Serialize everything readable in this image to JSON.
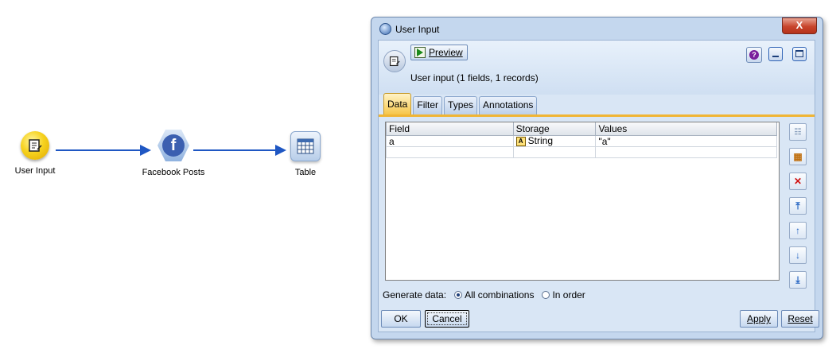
{
  "canvas": {
    "nodes": [
      {
        "label": "User Input",
        "icon": "user-input-icon"
      },
      {
        "label": "Facebook Posts",
        "icon": "facebook-icon"
      },
      {
        "label": "Table",
        "icon": "table-icon"
      }
    ],
    "facebook_glyph": "f"
  },
  "dialog": {
    "title": "User Input",
    "close_glyph": "X",
    "preview_label": "Preview",
    "help_glyph": "?",
    "summary": "User input (1 fields, 1 records)",
    "tabs": [
      {
        "label": "Data",
        "active": true
      },
      {
        "label": "Filter",
        "active": false
      },
      {
        "label": "Types",
        "active": false
      },
      {
        "label": "Annotations",
        "active": false
      }
    ],
    "table": {
      "headers": [
        "Field",
        "Storage",
        "Values"
      ],
      "rows": [
        {
          "field": "a",
          "storage_badge": "A",
          "storage": "String",
          "values": "\"a\""
        }
      ]
    },
    "tools": [
      "specify-values-icon",
      "add-field-icon",
      "delete-icon",
      "move-top-icon",
      "move-up-icon",
      "move-down-icon",
      "move-bottom-icon"
    ],
    "generate": {
      "label": "Generate data:",
      "options": [
        {
          "label": "All combinations",
          "selected": true
        },
        {
          "label": "In order",
          "selected": false
        }
      ]
    },
    "buttons": {
      "ok": "OK",
      "cancel": "Cancel",
      "apply": "Apply",
      "reset": "Reset"
    }
  },
  "colors": {
    "connector": "#1f57c3",
    "active_tab": "#f6c64a",
    "close": "#c8452c"
  }
}
